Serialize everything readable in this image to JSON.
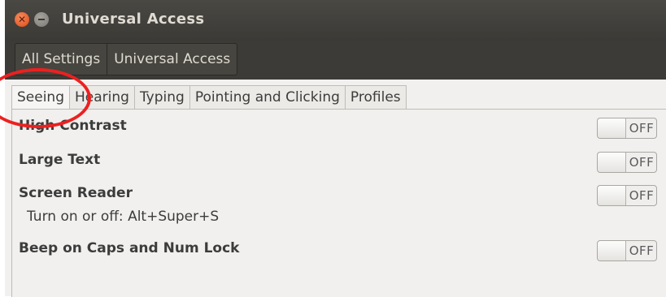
{
  "window": {
    "title": "Universal Access"
  },
  "breadcrumbs": [
    "All Settings",
    "Universal Access"
  ],
  "tabs": [
    {
      "label": "Seeing",
      "active": true
    },
    {
      "label": "Hearing",
      "active": false
    },
    {
      "label": "Typing",
      "active": false
    },
    {
      "label": "Pointing and Clicking",
      "active": false
    },
    {
      "label": "Profiles",
      "active": false
    }
  ],
  "settings": [
    {
      "label": "High Contrast",
      "state": "OFF"
    },
    {
      "label": "Large Text",
      "state": "OFF"
    },
    {
      "label": "Screen Reader",
      "state": "OFF",
      "hint": "Turn on or off: Alt+Super+S"
    },
    {
      "label": "Beep on Caps and Num Lock",
      "state": "OFF"
    }
  ],
  "icons": {
    "close": "close-icon",
    "minimize": "minimize-icon"
  },
  "colors": {
    "titlebar": "#3b3a36",
    "close_button": "#df4b16",
    "annotation": "#ed2020"
  }
}
